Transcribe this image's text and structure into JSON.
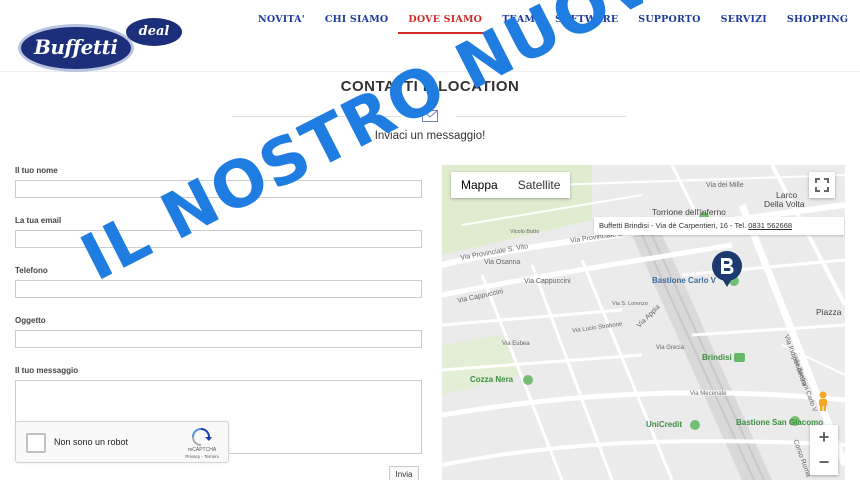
{
  "header": {
    "logo_text": "Buffetti",
    "logo_badge": "deal",
    "nav": [
      {
        "label": "NOVITA'"
      },
      {
        "label": "CHI SIAMO"
      },
      {
        "label": "DOVE SIAMO",
        "active": true
      },
      {
        "label": "TEAM"
      },
      {
        "label": "SOFTWARE"
      },
      {
        "label": "SUPPORTO"
      },
      {
        "label": "SERVIZI"
      },
      {
        "label": "SHOPPING"
      }
    ]
  },
  "section": {
    "title": "CONTATTI E LOCATION",
    "subtitle": "Inviaci un messaggio!"
  },
  "form": {
    "name_label": "Il tuo nome",
    "email_label": "La tua email",
    "phone_label": "Telefono",
    "subject_label": "Oggetto",
    "message_label": "Il tuo messaggio",
    "captcha_label": "Non sono un robot",
    "captcha_brand": "reCAPTCHA",
    "captcha_privacy": "Privacy - Termini",
    "send_label": "Invia"
  },
  "map": {
    "type_map": "Mappa",
    "type_satellite": "Satellite",
    "info": "Buffetti Brindisi - Via dè Carpentieri, 16 - Tel. ",
    "info_phone": "0831 562668",
    "labels": {
      "torrione": "Torrione dell'inferno",
      "bastione": "Bastione Carlo V",
      "brindisi": "Brindisi",
      "cozza": "Cozza Nera",
      "unicredit": "UniCredit",
      "san_giacomo": "Bastione San Giacomo",
      "larco": "Larco",
      "della_volta": "Della Volta",
      "piazza": "Piazza",
      "via_mille": "Via dei Mille",
      "prov_s_vito": "Via Provinciale S. Vito",
      "prov_s_vito2": "Via Provinciale S. Vito",
      "osanna": "Via Osanna",
      "cappuccini": "Via Cappuccini",
      "cappuccini2": "Via Cappuccini",
      "appia": "Via Appia",
      "indipendenza": "Via Indipendenza",
      "carlo_v": "Via Bastioni Carlo V",
      "corso_roma": "Corso Roma",
      "vicolo_botto": "Vicolo Botto",
      "via_lucio": "Via Lucio Strabone",
      "via_s_lorenzo": "Via S. Lorenzo",
      "via_eubea": "Via Eubea",
      "via_grecia": "Via Grecia",
      "via_mecenate": "Via Mecenate"
    }
  },
  "watermark": "IL NOSTRO NUOVO SITO",
  "colors": {
    "nav": "#1d3b9a",
    "nav_active": "#d12a2a",
    "watermark": "#1f7ce0",
    "logo": "#1c2f7a"
  }
}
